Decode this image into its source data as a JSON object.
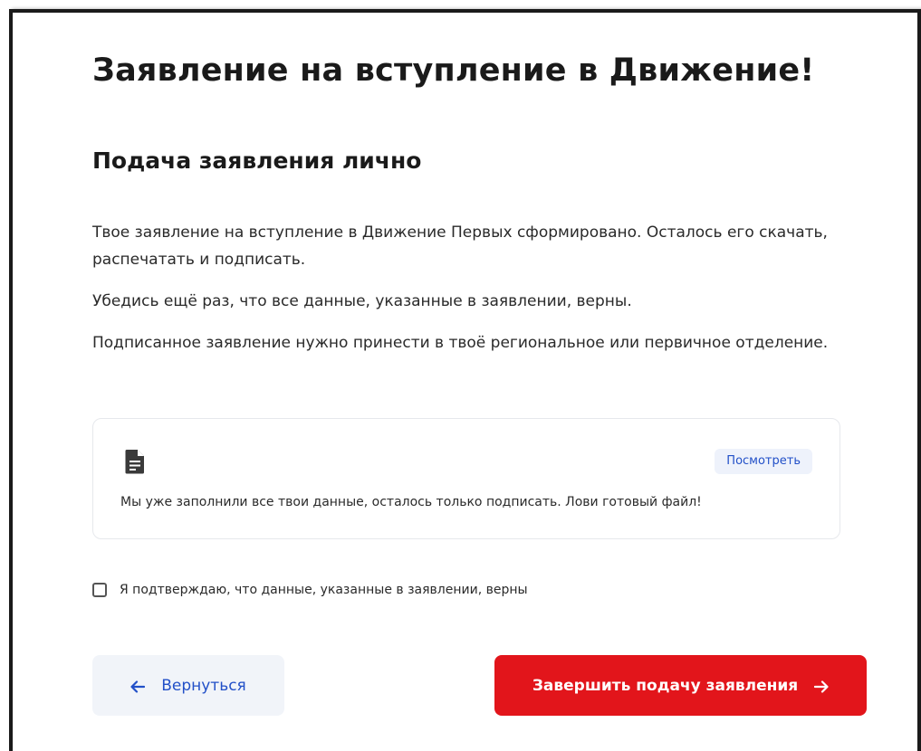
{
  "page": {
    "title": "Заявление на вступление в Движение!",
    "section_title": "Подача заявления лично",
    "paragraphs": [
      "Твое заявление на вступление в Движение Первых сформировано. Осталось его скачать, распечатать и подписать.",
      "Убедись ещё раз, что все данные, указанные в заявлении, верны.",
      "Подписанное заявление нужно принести в твоё региональное или первичное отделение."
    ]
  },
  "file_card": {
    "icon": "document-icon",
    "view_label": "Посмотреть",
    "text": "Мы уже заполнили все твои данные, осталось только подписать. Лови готовый файл!"
  },
  "confirm": {
    "checked": false,
    "label": "Я подтверждаю, что данные, указанные в заявлении, верны"
  },
  "actions": {
    "back_label": "Вернуться",
    "back_icon": "arrow-left-icon",
    "submit_label": "Завершить подачу заявления",
    "submit_icon": "arrow-right-icon"
  },
  "colors": {
    "accent_red": "#e2151b",
    "link_blue": "#2250c8",
    "light_bg": "#f1f4f9"
  }
}
